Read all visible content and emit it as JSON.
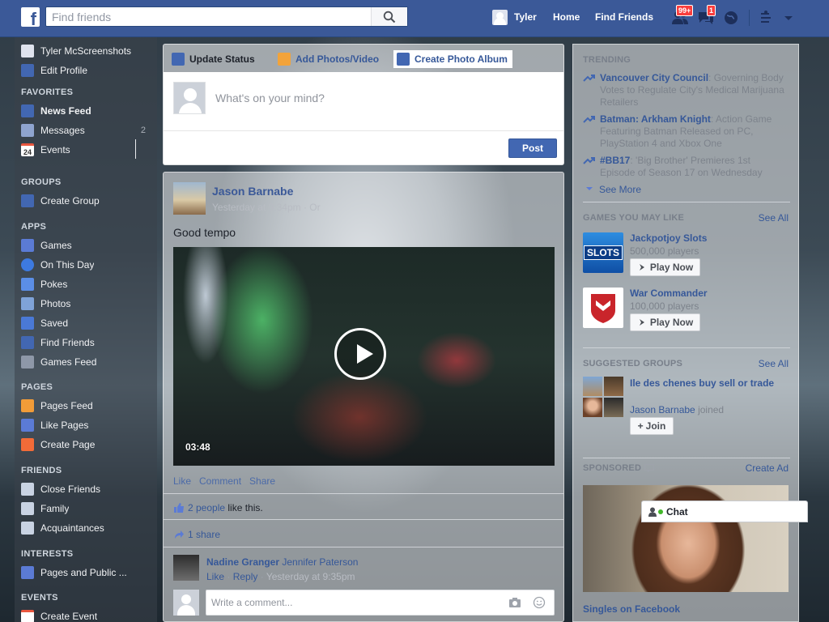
{
  "topbar": {
    "search_placeholder": "Find friends",
    "user_name": "Tyler",
    "home_label": "Home",
    "find_friends_label": "Find Friends",
    "friend_requests_count": "99+",
    "messages_count": "1",
    "brand_color": "#3b5998"
  },
  "leftnav": {
    "profile_name": "Tyler McScreenshots",
    "edit_profile": "Edit Profile",
    "sections": {
      "favorites": "FAVORITES",
      "groups": "GROUPS",
      "apps": "APPS",
      "pages": "PAGES",
      "friends": "FRIENDS",
      "interests": "INTERESTS",
      "events": "EVENTS"
    },
    "favorites": [
      "News Feed",
      "Messages",
      "Events"
    ],
    "messages_count": "2",
    "events_icon_text": "24",
    "groups": [
      "Create Group"
    ],
    "apps": [
      "Games",
      "On This Day",
      "Pokes",
      "Photos",
      "Saved",
      "Find Friends",
      "Games Feed"
    ],
    "pages": [
      "Pages Feed",
      "Like Pages",
      "Create Page"
    ],
    "friends": [
      "Close Friends",
      "Family",
      "Acquaintances"
    ],
    "interests": [
      "Pages and Public ..."
    ],
    "events": [
      "Create Event"
    ]
  },
  "composer": {
    "tabs": [
      "Update Status",
      "Add Photos/Video",
      "Create Photo Album"
    ],
    "placeholder": "What's on your mind?",
    "post_label": "Post"
  },
  "story": {
    "author": "Jason Barnabe",
    "time": "Yesterday at 9:34pm · Or",
    "text": "Good tempo",
    "video_duration": "03:48",
    "actions": [
      "Like",
      "Comment",
      "Share"
    ],
    "likes_link": "2 people",
    "likes_suffix": " like this.",
    "shares": "1 share",
    "comment": {
      "author": "Nadine Granger",
      "mention": "Jennifer Paterson",
      "like": "Like",
      "reply": "Reply",
      "time": "Yesterday at 9:35pm"
    },
    "write_placeholder": "Write a comment..."
  },
  "rightcol": {
    "trending_head": "TRENDING",
    "trending": [
      {
        "title": "Vancouver City Council",
        "desc": ": Governing Body Votes to Regulate City's Medical Marijuana Retailers"
      },
      {
        "title": "Batman: Arkham Knight",
        "desc": ": Action Game Featuring Batman Released on PC, PlayStation 4 and Xbox One"
      },
      {
        "title": "#BB17",
        "desc": ": 'Big Brother' Premieres 1st Episode of Season 17 on Wednesday"
      }
    ],
    "see_more": "See More",
    "games_head": "GAMES YOU MAY LIKE",
    "games_see_all": "See All",
    "games": [
      {
        "name": "Jackpotjoy Slots",
        "players": "500,000 players",
        "button": "Play Now",
        "logo_text": "SLOTS"
      },
      {
        "name": "War Commander",
        "players": "100,000 players",
        "button": "Play Now"
      }
    ],
    "groups_head": "SUGGESTED GROUPS",
    "groups_see_all": "See All",
    "group": {
      "name": "Ile des chenes buy sell or trade",
      "member": "Jason Barnabe",
      "joined": " joined",
      "button": "Join"
    },
    "sponsored_head": "SPONSORED",
    "create_ad": "Create Ad",
    "ad_title": "Singles on Facebook"
  },
  "chat": {
    "label": "Chat"
  }
}
